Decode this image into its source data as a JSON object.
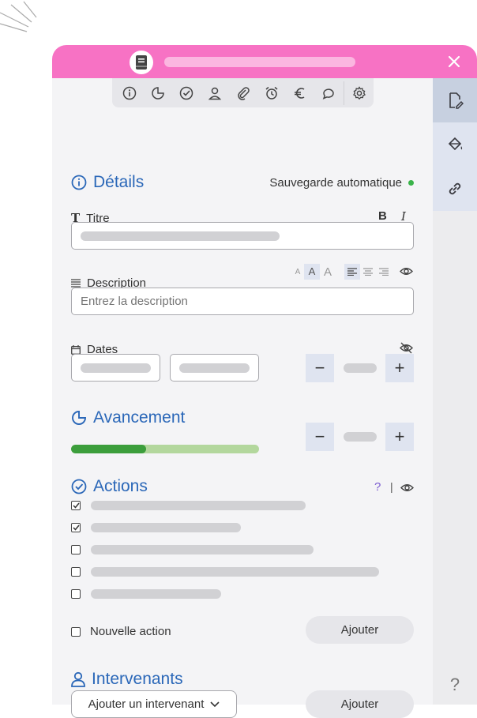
{
  "colors": {
    "header": "#f772c4",
    "accent": "#2a67b8",
    "progress_done": "#3c9e3c",
    "progress_rest": "#b3d79d",
    "status_dot": "#3ab34a"
  },
  "header": {
    "logo_icon": "book-icon",
    "close_icon": "close-icon"
  },
  "toolbar": {
    "icons": [
      "info-icon",
      "pie-chart-icon",
      "check-circle-icon",
      "person-icon",
      "paperclip-icon",
      "alarm-icon",
      "euro-icon",
      "comment-icon",
      "gear-icon"
    ]
  },
  "sidebar": {
    "tabs": [
      "edit-document-icon",
      "paint-bucket-icon",
      "link-icon"
    ],
    "help_label": "?"
  },
  "details": {
    "title": "Détails",
    "autosave": "Sauvegarde automatique",
    "titre_label": "Titre",
    "bold_label": "B",
    "italic_label": "I",
    "description_label": "Description",
    "description_placeholder": "Entrez la description",
    "font_size_labels": [
      "A",
      "A",
      "A"
    ],
    "dates_label": "Dates"
  },
  "progress": {
    "title": "Avancement",
    "value": 0.4,
    "minus": "−",
    "plus": "+"
  },
  "actions": {
    "title": "Actions",
    "help": "?",
    "separator": "|",
    "items": [
      {
        "checked": true
      },
      {
        "checked": true
      },
      {
        "checked": false
      },
      {
        "checked": false
      },
      {
        "checked": false
      }
    ],
    "new_action_label": "Nouvelle action",
    "add_label": "Ajouter"
  },
  "intervenants": {
    "title": "Intervenants",
    "select_label": "Ajouter un intervenant",
    "add_label": "Ajouter"
  },
  "dates_stepper": {
    "minus": "−",
    "plus": "+"
  }
}
